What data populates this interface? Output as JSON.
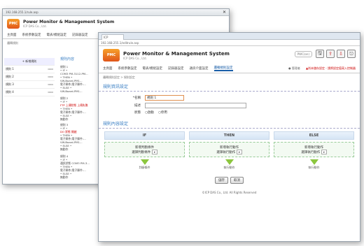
{
  "back_window": {
    "address": "192.168.255.1/rule.asp",
    "close_label": "✕",
    "system_title": "Power Monitor & Management System",
    "subtitle": "ICP DAS Co., Ltd.",
    "menu": [
      "主頁面",
      "系統參數設定",
      "電表/模組設定",
      "記錄器設定"
    ],
    "tab_label": "邏輯規則",
    "add_button": "+ 新增規則",
    "rule_list": [
      "規則 1",
      "規則 2",
      "規則 3",
      "規則 4"
    ],
    "panel_title": "規則內容",
    "rule_blocks": [
      {
        "name": "規則 1",
        "lines": [
          "• IF •",
          "COM3 PM-3112-PM...",
          "• THEN •",
          "VW-Board-PM1...",
          "電子郵件(電子郵件:...",
          "• ELSE •",
          "VW-Board-PM1..."
        ]
      },
      {
        "name": "規則 2",
        "lines": [
          "• IF •",
          "FTP 上傳狀態 上傳失敗",
          "• THEN •",
          "電子郵件(電子郵件:...",
          "• ELSE •",
          "無動作"
        ]
      },
      {
        "name": "規則 3",
        "lines": [
          "• IF •",
          "DO 狀態 開啟",
          "• THEN •",
          "電子郵件(電子郵件:...",
          "VW-Board-PM1...",
          "• ELSE •",
          "無動作"
        ]
      },
      {
        "name": "規則 4",
        "lines": [
          "• IF •",
          "通訊狀態 COM3 PM-3...",
          "• THEN •",
          "電子郵件(電子郵件:...",
          "• ELSE •",
          "無動作"
        ]
      }
    ]
  },
  "front_window": {
    "tab_label": "ICP",
    "address": "192.168.255.1/editrule.asp",
    "system_title": "Power Monitor & Management System",
    "subtitle": "ICP DAS Co., Ltd.",
    "password_btn": "PWC(on)",
    "menu": [
      "主頁面",
      "系統參數設定",
      "電表/模組設定",
      "記錄器設定",
      "通訊介面設定",
      "邏輯規則設定"
    ],
    "menu_active_index": 5,
    "menu_right": "▲尚未儲存設定 - 請將設定值寫入控制器",
    "menu_user": "● 管理者",
    "breadcrumb": "邏輯規則設定 > 規則設定",
    "section_info": "規則資訊設定",
    "name_label": "*名稱",
    "name_value": "規則 1",
    "desc_label": "描述",
    "desc_value": "",
    "status_label": "狀態",
    "status_on": "○啟動",
    "status_off": "○停用",
    "section_content": "規則內容設定",
    "columns": [
      {
        "header": "IF",
        "line1": "新增判斷條件",
        "line2": "選擇判斷條件",
        "result": "判斷條件"
      },
      {
        "header": "THEN",
        "line1": "新增執行動作",
        "line2": "選擇執行動作",
        "result": "執行動作"
      },
      {
        "header": "ELSE",
        "line1": "新增執行動作",
        "line2": "選擇執行動作",
        "result": "執行動作"
      }
    ],
    "save_btn": "儲存",
    "cancel_btn": "取消",
    "footer": "©ICP DAS Co., Ltd. All Rights Reserved"
  }
}
